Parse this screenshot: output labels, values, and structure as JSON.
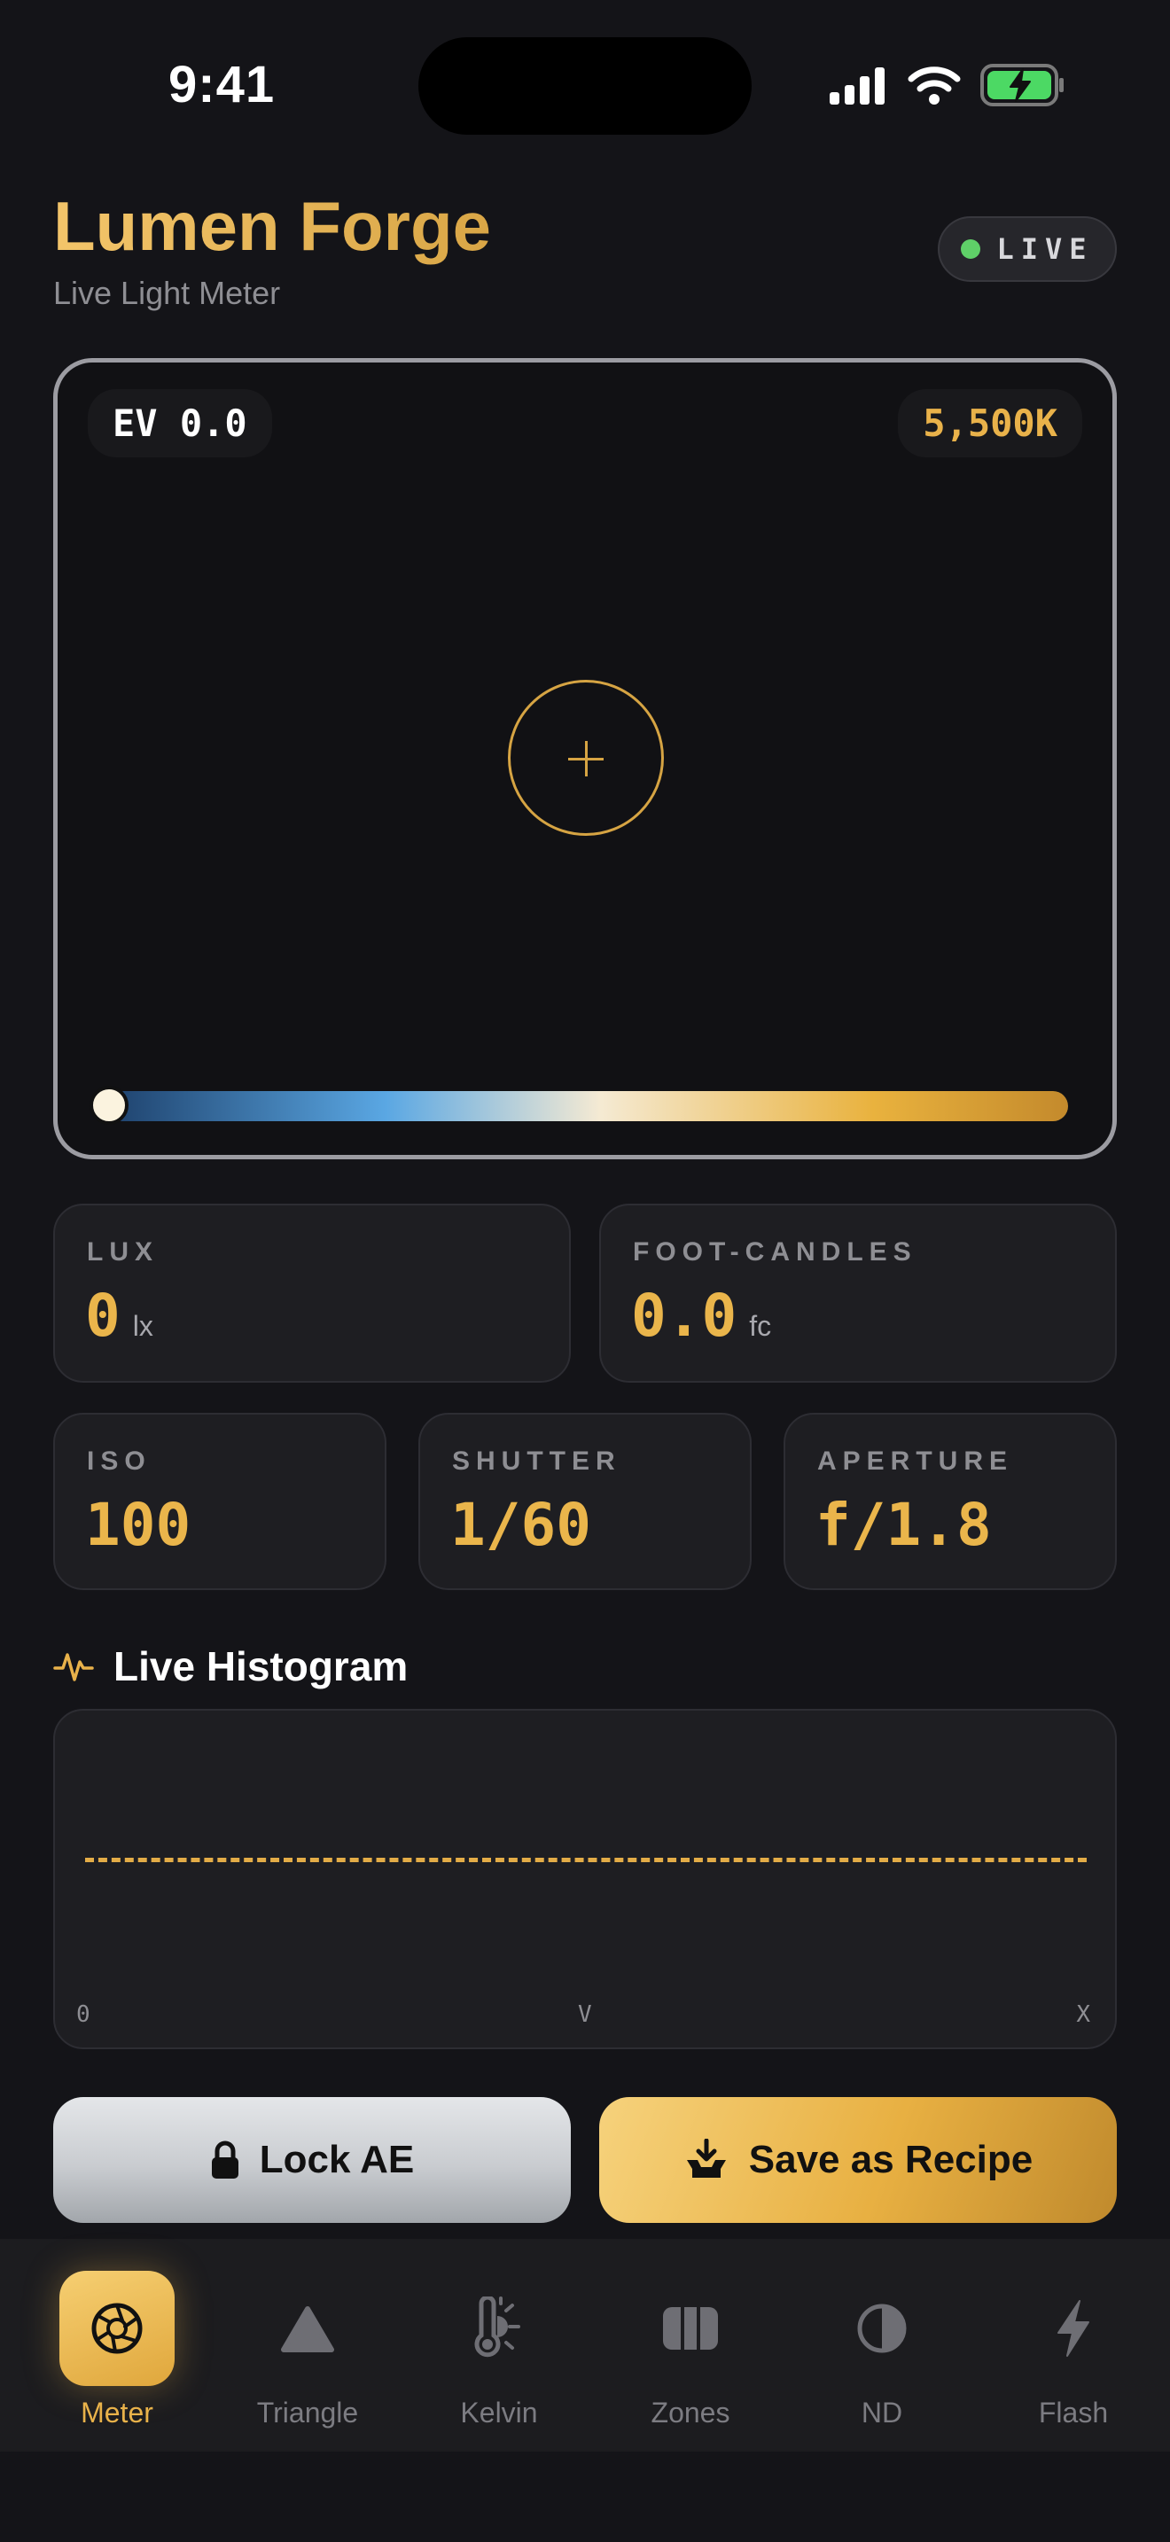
{
  "status_bar": {
    "time": "9:41"
  },
  "header": {
    "title": "Lumen Forge",
    "subtitle": "Live Light Meter",
    "live_label": "LIVE",
    "live_color": "#5fd068"
  },
  "viewfinder": {
    "ev_label": "EV 0.0",
    "kelvin_label": "5,500K",
    "kelvin_slider_position": 0
  },
  "readings": {
    "lux": {
      "label": "LUX",
      "value": "0",
      "unit": "lx"
    },
    "footcandles": {
      "label": "FOOT-CANDLES",
      "value": "0.0",
      "unit": "fc"
    },
    "iso": {
      "label": "ISO",
      "value": "100"
    },
    "shutter": {
      "label": "SHUTTER",
      "value": "1/60"
    },
    "aperture": {
      "label": "APERTURE",
      "value": "f/1.8"
    }
  },
  "histogram": {
    "title": "Live Histogram",
    "ticks": [
      "0",
      "V",
      "X"
    ]
  },
  "actions": {
    "lock_label": "Lock AE",
    "save_label": "Save as Recipe"
  },
  "tabbar": {
    "items": [
      {
        "label": "Meter",
        "icon": "aperture-icon",
        "active": true
      },
      {
        "label": "Triangle",
        "icon": "triangle-icon",
        "active": false
      },
      {
        "label": "Kelvin",
        "icon": "thermometer-sun-icon",
        "active": false
      },
      {
        "label": "Zones",
        "icon": "columns-icon",
        "active": false
      },
      {
        "label": "ND",
        "icon": "half-circle-icon",
        "active": false
      },
      {
        "label": "Flash",
        "icon": "bolt-icon",
        "active": false
      }
    ]
  },
  "colors": {
    "accent": "#e9b24a",
    "background": "#141418",
    "card": "#1e1e22"
  }
}
